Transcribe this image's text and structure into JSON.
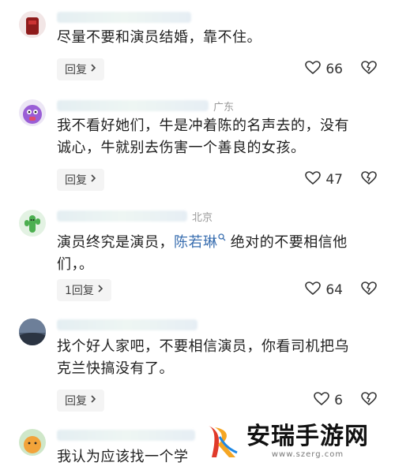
{
  "comments": [
    {
      "region": "",
      "text_parts": [
        "尽量不要和演员结婚，靠不住。"
      ],
      "mention": "",
      "text_after": "",
      "reply_label": "回复",
      "likes": "66"
    },
    {
      "region": "广东",
      "text_parts": [
        "我不看好她们，牛是冲着陈的名声去的，没有",
        "诚心，牛就别去伤害一个善良的女孩。"
      ],
      "mention": "",
      "text_after": "",
      "reply_label": "回复",
      "likes": "47"
    },
    {
      "region": "北京",
      "text_parts": [
        "演员终究是演员，"
      ],
      "mention": "陈若琳",
      "text_after": " 绝对的不要相信他",
      "text_line2": "们，。",
      "reply_label": "1回复",
      "likes": "64"
    },
    {
      "region": "",
      "text_parts": [
        "找个好人家吧，不要相信演员，你看司机把乌",
        "克兰快搞没有了。"
      ],
      "mention": "",
      "text_after": "",
      "reply_label": "回复",
      "likes": "6"
    },
    {
      "region": "",
      "text_parts": [
        "我认为应该找一个学"
      ],
      "mention": "",
      "text_after": "",
      "reply_label": "",
      "likes": ""
    }
  ],
  "watermark": {
    "title": "安瑞手游网",
    "url": "www.szerg.com"
  },
  "icons": {
    "like": "heart-outline-icon",
    "dislike": "broken-heart-icon",
    "chevron": "chevron-right-icon",
    "mention": "search-icon"
  },
  "colors": {
    "mention": "#3a6fb0",
    "reply_bg": "#f4f4f4",
    "text": "#1f1f1f",
    "meta": "#9a9a9a"
  }
}
